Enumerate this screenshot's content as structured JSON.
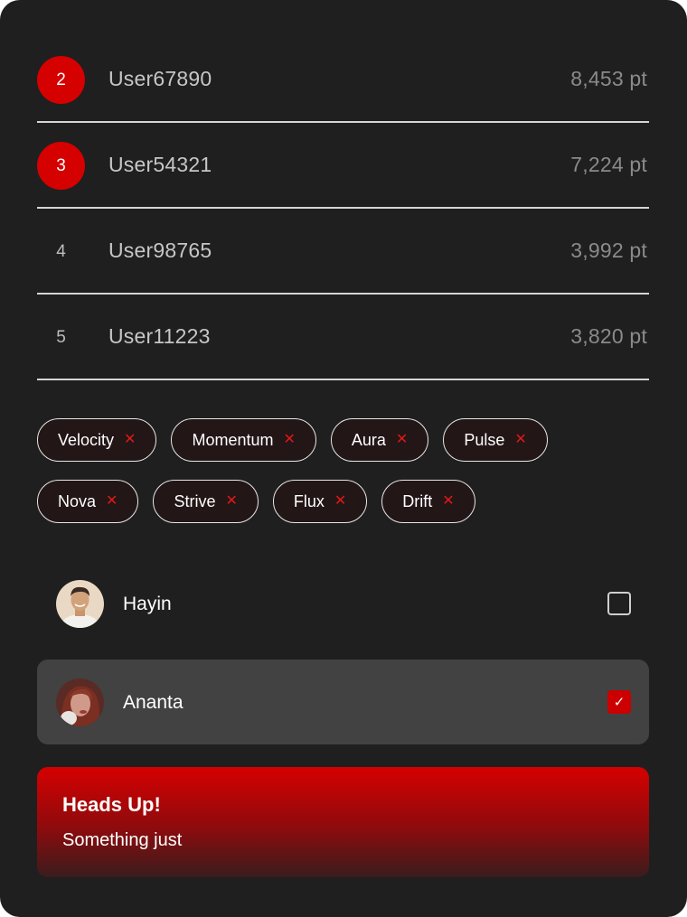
{
  "leaderboard": [
    {
      "rank": "2",
      "user": "User67890",
      "points": "8,453 pt",
      "badge": true
    },
    {
      "rank": "3",
      "user": "User54321",
      "points": "7,224 pt",
      "badge": true
    },
    {
      "rank": "4",
      "user": "User98765",
      "points": "3,992 pt",
      "badge": false
    },
    {
      "rank": "5",
      "user": "User11223",
      "points": "3,820 pt",
      "badge": false
    }
  ],
  "tags": {
    "row1": [
      "Velocity",
      "Momentum",
      "Aura",
      "Pulse"
    ],
    "row2": [
      "Nova",
      "Strive",
      "Flux",
      "Drift"
    ],
    "remove_glyph": "✕"
  },
  "people": [
    {
      "name": "Hayin",
      "checked": false
    },
    {
      "name": "Ananta",
      "checked": true,
      "check_glyph": "✓"
    }
  ],
  "alert": {
    "title": "Heads Up!",
    "body": "Something just"
  },
  "colors": {
    "accent": "#d50000",
    "card_bg": "#1f1f1f",
    "selected_row_bg": "#424242"
  }
}
